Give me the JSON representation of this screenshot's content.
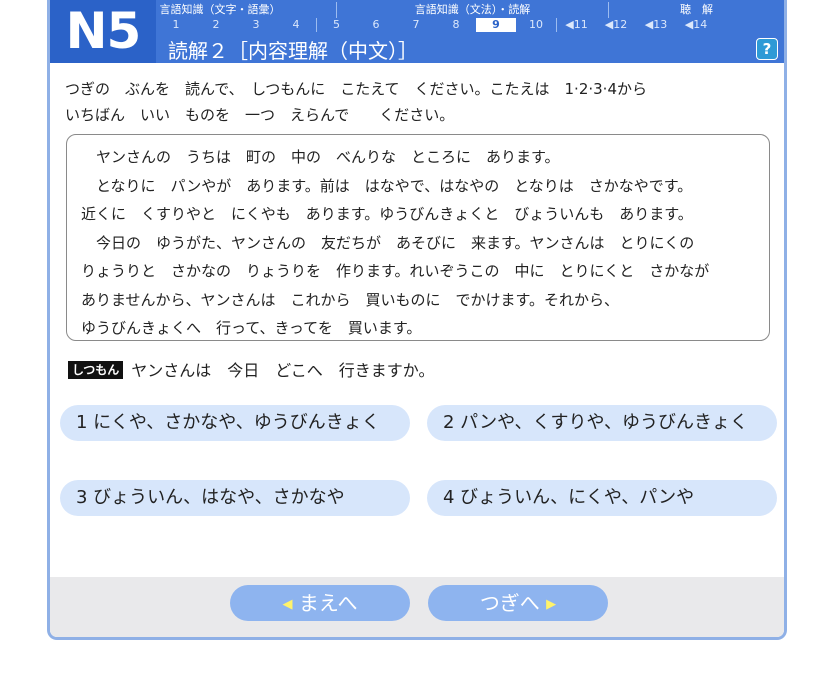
{
  "header": {
    "level": "N5",
    "categories": [
      "言語知識（文字・語彙）",
      "言語知識（文法）・読解",
      "聴　解"
    ],
    "numbers": [
      "1",
      "2",
      "3",
      "4",
      "5",
      "6",
      "7",
      "8",
      "9",
      "10",
      "◀11",
      "◀12",
      "◀13",
      "◀14"
    ],
    "active_number": "9",
    "title": "読解２［内容理解（中文）］",
    "help_label": "?"
  },
  "instruction": {
    "line1": "つぎの　ぶんを　読んで、　しつもんに　こたえて　ください。こたえは　1·2·3·4から",
    "line2": "いちばん　いい　ものを　一つ　えらんで　　ください。"
  },
  "passage": {
    "lines": [
      "　ヤンさんの　うちは　町の　中の　べんりな　ところに　あります。",
      "　となりに　パンやが　あります。前は　はなやで、はなやの　となりは　さかなやです。",
      "近くに　くすりやと　にくやも　あります。ゆうびんきょくと　びょういんも　あります。",
      "　今日の　ゆうがた、ヤンさんの　友だちが　あそびに　来ます。ヤンさんは　とりにくの",
      "りょうりと　さかなの　りょうりを　作ります。れいぞうこの　中に　とりにくと　さかなが",
      "ありませんから、ヤンさんは　これから　買いものに　でかけます。それから、",
      "ゆうびんきょくへ　行って、きってを　買います。"
    ]
  },
  "question": {
    "tag": "しつもん",
    "text": "ヤンさんは　今日　どこへ　行きますか。"
  },
  "options": [
    "1  にくや、さかなや、ゆうびんきょく",
    "2  パンや、くすりや、ゆうびんきょく",
    "3  びょういん、はなや、さかなや",
    "4  びょういん、にくや、パンや"
  ],
  "footer": {
    "prev_label": "まえへ",
    "next_label": "つぎへ"
  },
  "colors": {
    "header_blue": "#3f75d6",
    "level_blue": "#2b62c8",
    "option_bg": "#d7e6fb",
    "nav_button": "#8eb4ef",
    "help_button": "#2e9ad6"
  }
}
